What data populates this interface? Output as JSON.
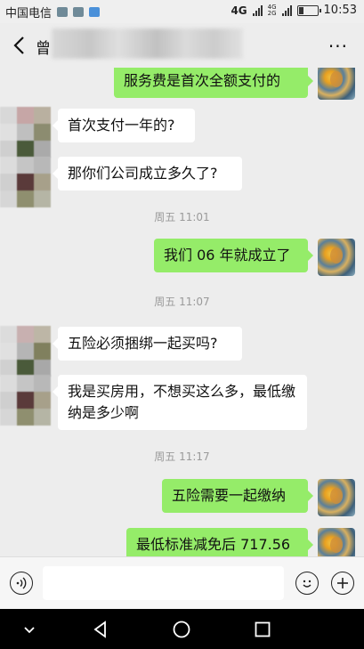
{
  "status_bar": {
    "carrier": "中国电信",
    "network_main": "4G",
    "network_stack_top": "4G",
    "network_stack_bottom": "2G",
    "time": "10:53",
    "battery_level": 0.25
  },
  "header": {
    "contact_name_visible": "曾",
    "more_label": "···"
  },
  "messages": [
    {
      "side": "out",
      "text": "服务费是首次全额支付的"
    },
    {
      "side": "in",
      "text": "首次支付一年的?"
    },
    {
      "side": "in",
      "text": "那你们公司成立多久了?"
    },
    {
      "type": "time",
      "text": "周五 11:01"
    },
    {
      "side": "out",
      "text": "我们 06 年就成立了"
    },
    {
      "type": "time",
      "text": "周五 11:07"
    },
    {
      "side": "in",
      "text": "五险必须捆绑一起买吗?"
    },
    {
      "side": "in",
      "text": "我是买房用，不想买这么多，最低缴纳是多少啊"
    },
    {
      "type": "time",
      "text": "周五 11:17"
    },
    {
      "side": "out",
      "text": "五险需要一起缴纳"
    },
    {
      "side": "out",
      "text": "最低标准减免后 717.56"
    }
  ],
  "input_bar": {
    "message_value": "",
    "voice_icon": "voice-icon",
    "emoji_icon": "emoji-icon",
    "add_icon": "plus-icon"
  },
  "nav_bar": {
    "icons": [
      "collapse-icon",
      "back-triangle-icon",
      "home-circle-icon",
      "recents-square-icon"
    ]
  },
  "colors": {
    "outgoing_bubble": "#95ec69",
    "incoming_bubble": "#ffffff",
    "chat_background": "#ededed"
  }
}
